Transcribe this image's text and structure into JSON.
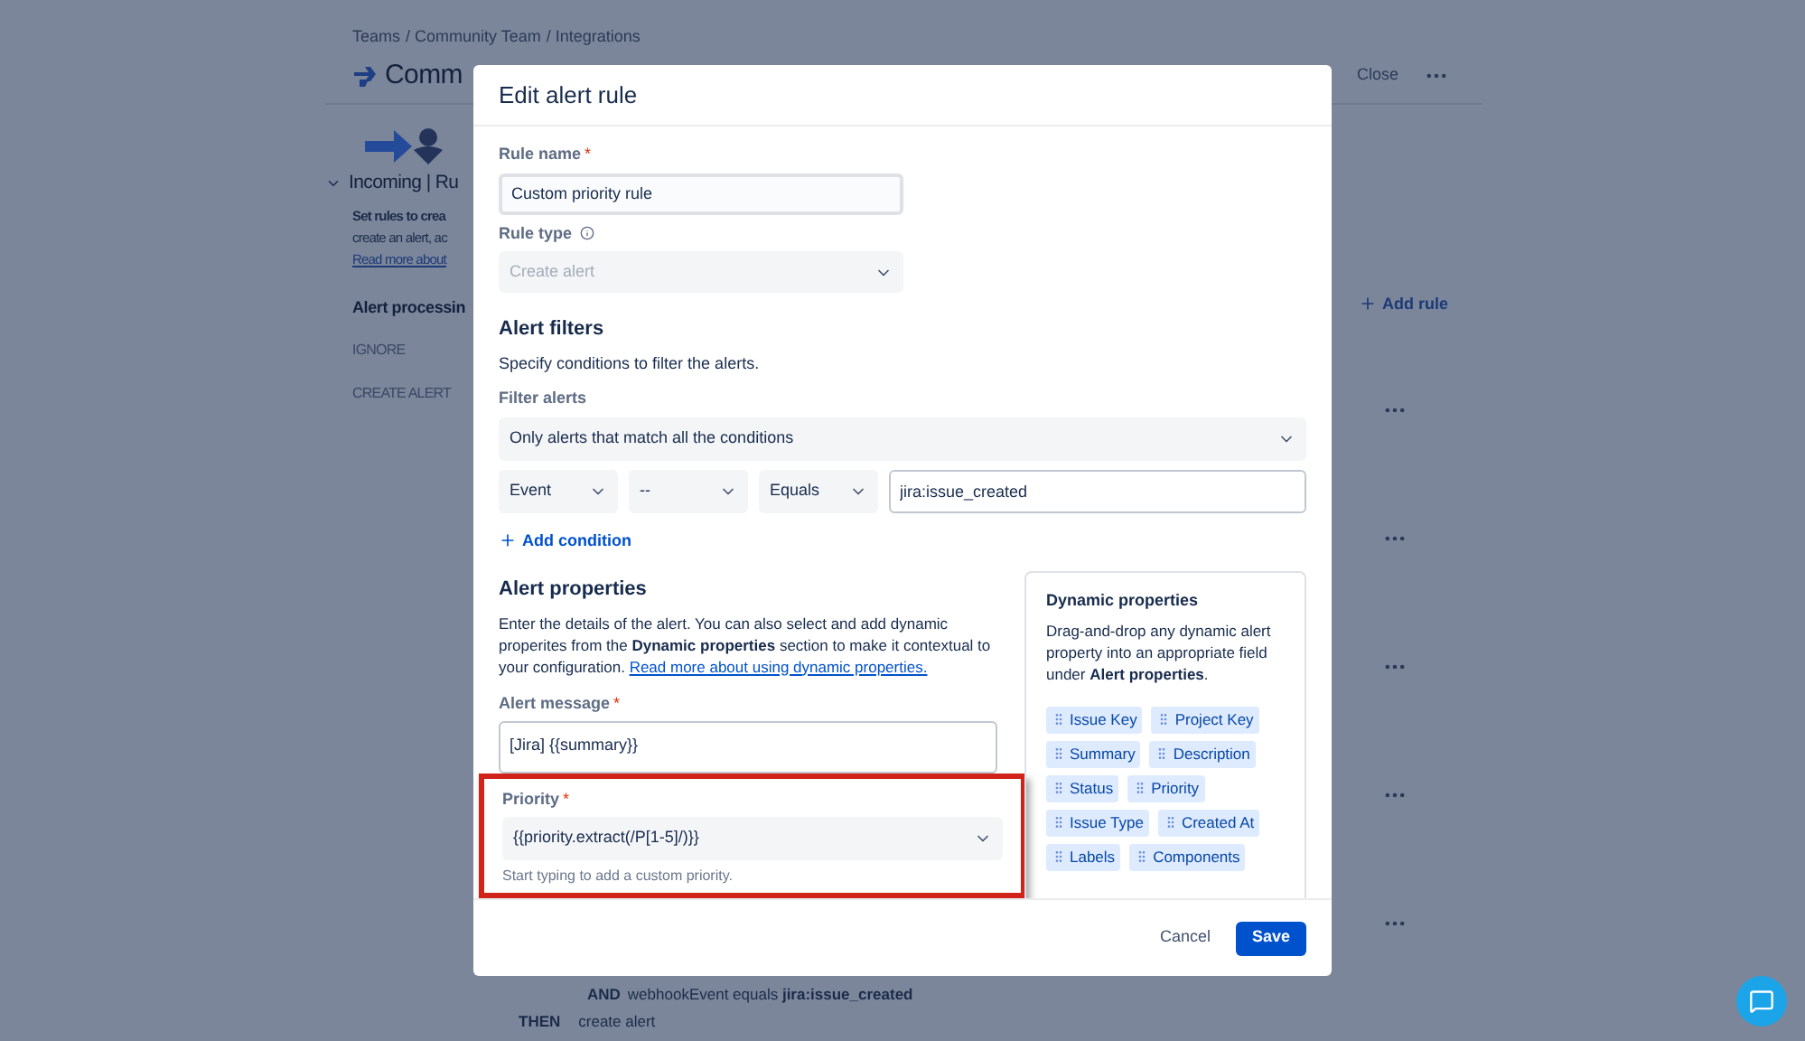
{
  "background": {
    "breadcrumbs": [
      "Teams",
      "/ Community Team",
      "/ Integrations"
    ],
    "title": "Comm",
    "close": "Close",
    "section_title": "Incoming | Ru",
    "description_lines": [
      "Set rules to crea",
      "create an alert, ac"
    ],
    "link": "Read more about",
    "processing_title": "Alert processin",
    "rule_actions": [
      "IGNORE",
      "CREATE ALERT"
    ],
    "add_rule": "Add rule",
    "bottom_rule": {
      "and_keyword": "AND",
      "condition": "webhookEvent equals **jira:issue_created**",
      "then_keyword": "THEN",
      "action": "create alert"
    }
  },
  "dialog": {
    "title": "Edit alert rule",
    "rule_name": {
      "label": "Rule name",
      "required_mark": "*",
      "value": "Custom priority rule"
    },
    "rule_type": {
      "label": "Rule type",
      "value": "Create alert",
      "disabled": true
    },
    "alert_filters": {
      "heading": "Alert filters",
      "description": "Specify conditions to filter the alerts.",
      "filter_label": "Filter alerts",
      "match": "Only alerts that match all the conditions",
      "condition": {
        "field": "Event",
        "path": "--",
        "operator": "Equals",
        "value": "jira:issue_created"
      },
      "add_condition": "Add condition"
    },
    "alert_properties": {
      "heading": "Alert properties",
      "description": "Enter the details of the alert. You can also select and add dynamic properites from the **Dynamic properties** section to make it contextual to your configuration.",
      "link": "Read more about using dynamic properties.",
      "message": {
        "label": "Alert message",
        "required_mark": "*",
        "value": "[Jira] {{summary}}"
      },
      "priority": {
        "label": "Priority",
        "required_mark": "*",
        "value": "{{priority.extract(/P[1-5]/)}}",
        "hint": "Start typing to add a custom priority.",
        "highlighted": true
      }
    },
    "dynamic_properties": {
      "title": "Dynamic properties",
      "description": "Drag-and-drop any dynamic alert property into an appropriate field under **Alert properties**.",
      "tags": [
        "Issue Key",
        "Project Key",
        "Summary",
        "Description",
        "Status",
        "Priority",
        "Issue Type",
        "Created At",
        "Labels",
        "Components"
      ]
    },
    "buttons": {
      "cancel": "Cancel",
      "save": "Save"
    }
  }
}
